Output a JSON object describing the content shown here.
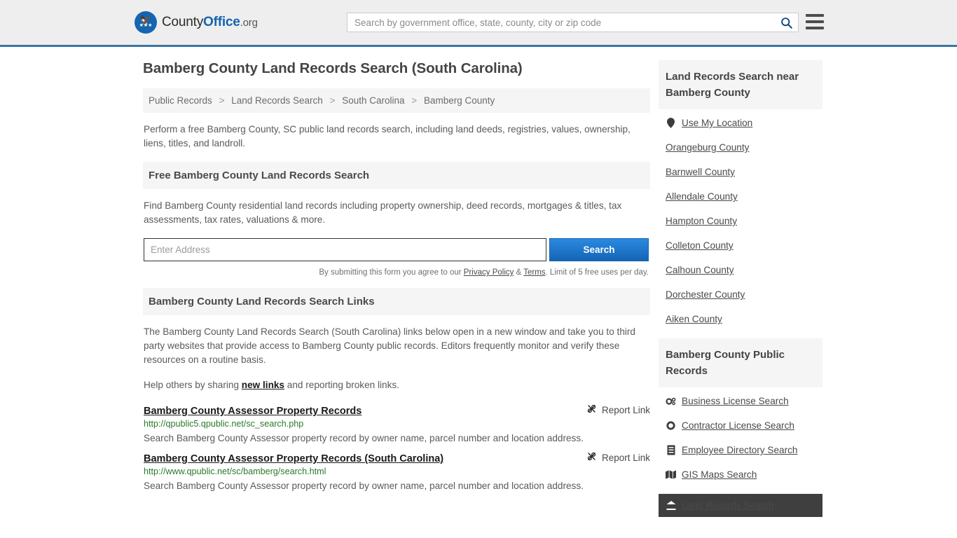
{
  "header": {
    "logo": {
      "part1": "County",
      "part2": "Office",
      "part3": ".org"
    },
    "search": {
      "placeholder": "Search by government office, state, county, city or zip code",
      "value": ""
    },
    "search_icon": "search-icon",
    "menu_icon": "hamburger-menu-icon"
  },
  "page": {
    "title": "Bamberg County Land Records Search (South Carolina)",
    "breadcrumb": [
      "Public Records",
      "Land Records Search",
      "South Carolina",
      "Bamberg County"
    ],
    "breadcrumb_separator": ">",
    "intro": "Perform a free Bamberg County, SC public land records search, including land deeds, registries, values, ownership, liens, titles, and landroll."
  },
  "free_search": {
    "heading": "Free Bamberg County Land Records Search",
    "description": "Find Bamberg County residential land records including property ownership, deed records, mortgages & titles, tax assessments, tax rates, valuations & more.",
    "address_placeholder": "Enter Address",
    "address_value": "",
    "search_button": "Search",
    "legal_prefix": "By submitting this form you agree to our ",
    "privacy_policy": "Privacy Policy",
    "legal_amp": " & ",
    "terms": "Terms",
    "legal_suffix": ". Limit of 5 free uses per day."
  },
  "search_links": {
    "heading": "Bamberg County Land Records Search Links",
    "description": "The Bamberg County Land Records Search (South Carolina) links below open in a new window and take you to third party websites that provide access to Bamberg County public records. Editors frequently monitor and verify these resources on a routine basis.",
    "help_prefix": "Help others by sharing ",
    "help_link": "new links",
    "help_suffix": " and reporting broken links.",
    "report_label": "Report Link",
    "report_icon": "broken-link-icon",
    "items": [
      {
        "title": "Bamberg County Assessor Property Records",
        "url": "http://qpublic5.qpublic.net/sc_search.php",
        "description": "Search Bamberg County Assessor property record by owner name, parcel number and location address."
      },
      {
        "title": "Bamberg County Assessor Property Records (South Carolina)",
        "url": "http://www.qpublic.net/sc/bamberg/search.html",
        "description": "Search Bamberg County Assessor property record by owner name, parcel number and location address."
      }
    ]
  },
  "sidebar": {
    "nearby": {
      "heading": "Land Records Search near Bamberg County",
      "items": [
        {
          "label": "Use My Location",
          "icon": "map-pin-icon"
        },
        {
          "label": "Orangeburg County",
          "icon": ""
        },
        {
          "label": "Barnwell County",
          "icon": ""
        },
        {
          "label": "Allendale County",
          "icon": ""
        },
        {
          "label": "Hampton County",
          "icon": ""
        },
        {
          "label": "Colleton County",
          "icon": ""
        },
        {
          "label": "Calhoun County",
          "icon": ""
        },
        {
          "label": "Dorchester County",
          "icon": ""
        },
        {
          "label": "Aiken County",
          "icon": ""
        }
      ]
    },
    "public_records": {
      "heading": "Bamberg County Public Records",
      "items": [
        {
          "label": "Business License Search",
          "icon": "gears-icon",
          "active": false
        },
        {
          "label": "Contractor License Search",
          "icon": "gear-icon",
          "active": false
        },
        {
          "label": "Employee Directory Search",
          "icon": "document-icon",
          "active": false
        },
        {
          "label": "GIS Maps Search",
          "icon": "map-icon",
          "active": false
        },
        {
          "label": "Land Records Search",
          "icon": "landmark-icon",
          "active": true
        }
      ]
    }
  },
  "colors": {
    "brand_blue": "#1565b0",
    "header_border": "#3c74a8",
    "url_green": "#2a7a2a",
    "section_bg": "#f5f5f5",
    "active_bg": "#3f3f3f"
  }
}
